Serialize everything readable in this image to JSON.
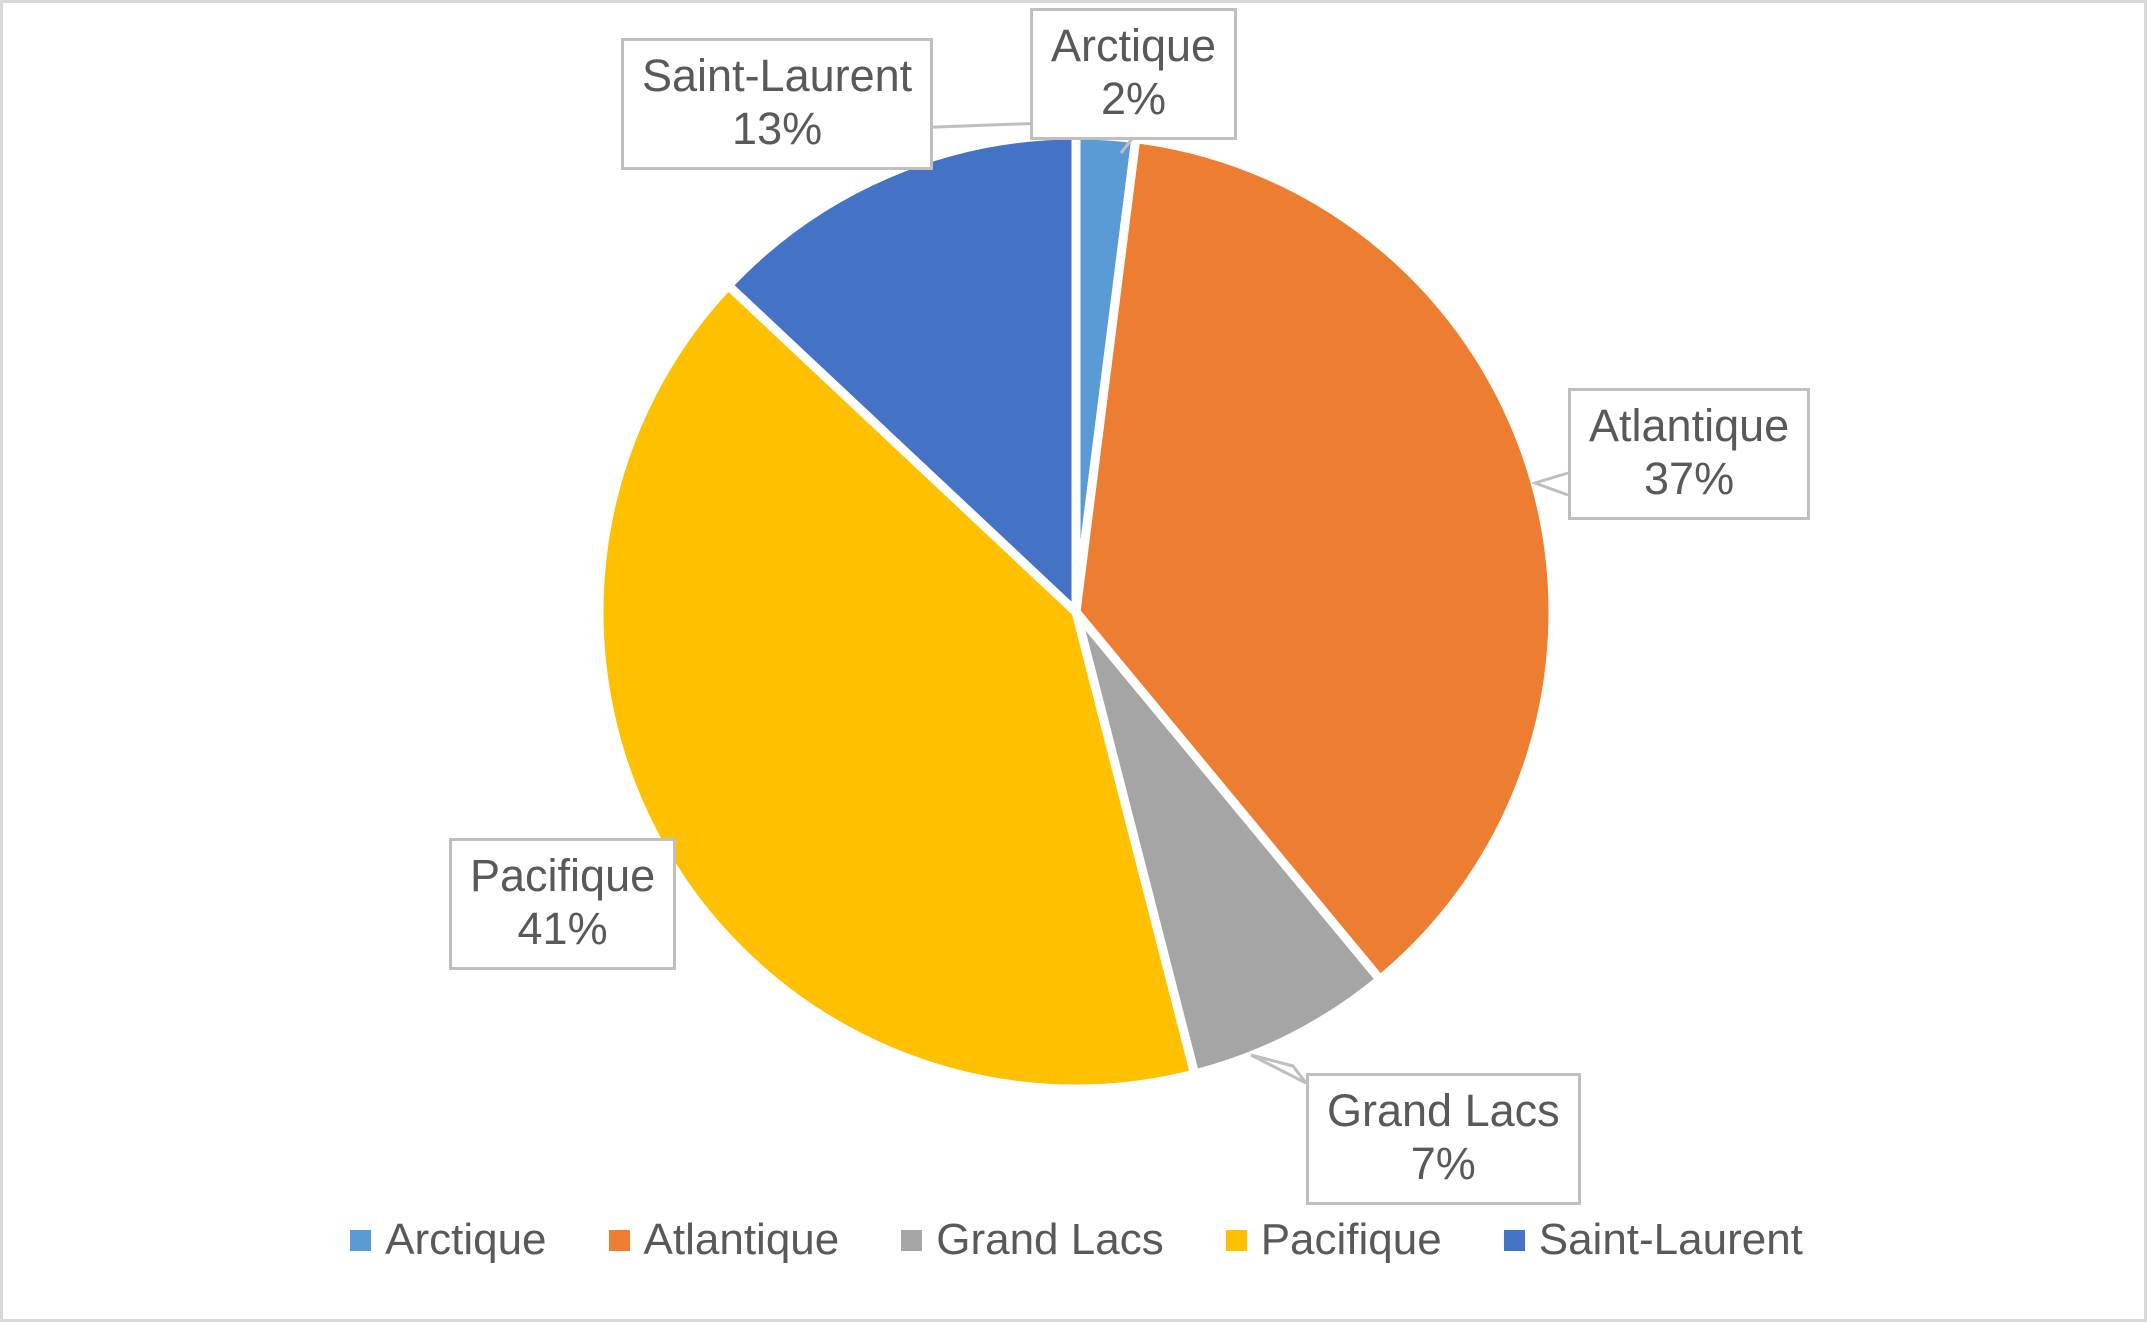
{
  "chart_data": {
    "type": "pie",
    "title": "",
    "subtitle": "",
    "xlabel": "",
    "ylabel": "",
    "grid": false,
    "legend_position": "bottom",
    "labels_show": "category name and percentage",
    "start_angle_deg": 0,
    "direction": "clockwise",
    "slice_gap": "white separator",
    "categories": [
      "Arctique",
      "Atlantique",
      "Grand Lacs",
      "Pacifique",
      "Saint-Laurent"
    ],
    "values": [
      2,
      37,
      7,
      41,
      13
    ],
    "units": "percent",
    "colors": [
      "#5B9BD5",
      "#ED7D31",
      "#A5A5A5",
      "#FFC000",
      "#4472C4"
    ],
    "slices": [
      {
        "name": "Arctique",
        "value": 2,
        "value_label": "2%",
        "color": "#5B9BD5",
        "start_deg": 0,
        "end_deg": 7.2
      },
      {
        "name": "Atlantique",
        "value": 37,
        "value_label": "37%",
        "color": "#ED7D31",
        "start_deg": 7.2,
        "end_deg": 140.4
      },
      {
        "name": "Grand Lacs",
        "value": 7,
        "value_label": "7%",
        "color": "#A5A5A5",
        "start_deg": 140.4,
        "end_deg": 165.6
      },
      {
        "name": "Pacifique",
        "value": 41,
        "value_label": "41%",
        "color": "#FFC000",
        "start_deg": 165.6,
        "end_deg": 313.2
      },
      {
        "name": "Saint-Laurent",
        "value": 13,
        "value_label": "13%",
        "color": "#4472C4",
        "start_deg": 313.2,
        "end_deg": 360
      }
    ]
  },
  "callouts": {
    "arctique": {
      "name": "Arctique",
      "value": "2%"
    },
    "atlantique": {
      "name": "Atlantique",
      "value": "37%"
    },
    "grand_lacs": {
      "name": "Grand Lacs",
      "value": "7%"
    },
    "pacifique": {
      "name": "Pacifique",
      "value": "41%"
    },
    "saint_laurent": {
      "name": "Saint-Laurent",
      "value": "13%"
    }
  },
  "legend": {
    "items": [
      {
        "label": "Arctique",
        "color": "#5B9BD5"
      },
      {
        "label": "Atlantique",
        "color": "#ED7D31"
      },
      {
        "label": "Grand Lacs",
        "color": "#A5A5A5"
      },
      {
        "label": "Pacifique",
        "color": "#FFC000"
      },
      {
        "label": "Saint-Laurent",
        "color": "#4472C4"
      }
    ]
  },
  "style": {
    "plot_background": "#FFFFFF",
    "frame_border": "#D9D9D9",
    "label_border": "#BFBFBF",
    "text_color": "#595959",
    "slice_separator": "#FFFFFF"
  }
}
